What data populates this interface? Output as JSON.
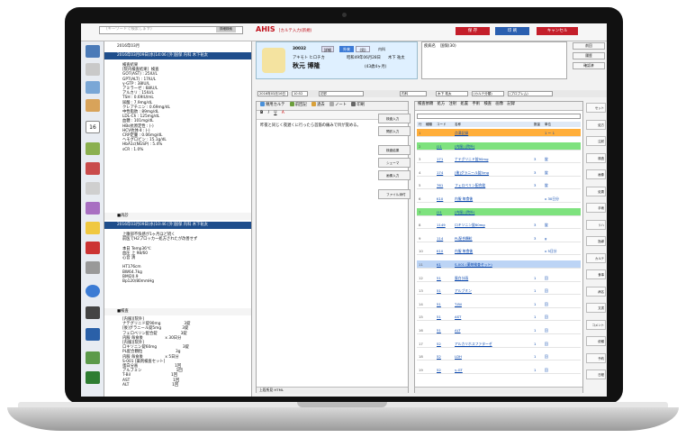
{
  "search": {
    "placeholder": "(キーワードで検索します)",
    "button": "詳細検索"
  },
  "app": {
    "logo": "AHIS",
    "window_title": "[カルテ入力(新規)"
  },
  "topbar": {
    "btn_save": "保 存",
    "btn_print": "印 刷",
    "btn_cancel": "キャンセル"
  },
  "patient": {
    "id": "30032",
    "kana": "アキモト ヒロチカ",
    "name": "秋元 博隆",
    "dob": "昭和49年06月28日",
    "age": "(43歳4ヶ月)",
    "doctor": "木下 祐太",
    "dept": "内科",
    "insurance": "国保(30)",
    "type_out": "外来",
    "sex": "(男)",
    "detail": "詳細"
  },
  "memo": {
    "label": "疾病名",
    "value": "国保(30)"
  },
  "right_side": [
    "前回",
    "履歴",
    "確認済"
  ],
  "filters": {
    "date": "2016年03月16日",
    "time": "10:52",
    "dept": "初診",
    "section": "内科",
    "doctor": "木下 祐太",
    "karte": "(カルテ分類)",
    "problem": "(プロブレム)"
  },
  "history": [
    {
      "header": "2016年03月",
      "kind": "month"
    },
    {
      "header": "2016年03月09日(水)14:06 [外]国保 内科 木下祐太",
      "kind": "visit"
    },
    {
      "text": "検査結果\n[院内検査結果]  検査\nGOT(AST) : 25IU/L\nGPT(ALT) : 17IU/L\nγ-GTP : 38IU/L\nアミラーゼ : 68IU/L\nアルカリ : 15IU/L\nTSH : 0.69IU/mL\n尿酸 : 7.9mg/dL\nクレアチニン : 0.69mg/dL\n中性脂肪 : 89mg/dL\nLDL-Ch : 125mg/dL\n血糖 : 101mg/dL\nHBs抗原定性 : (-)\nHCV抗体-Ⅱ : (-)\nCRP定量 : 0.06mg/dL\nヘモグロビン : 15.1g/dL\nHbA1c(NGSP) : 5.4%\nsCR : 1.0%"
    },
    {
      "header": "■再診",
      "kind": "sub",
      "count": "1"
    },
    {
      "header": "2016年03月09日(水)10:46 [外]国保 内科 木下祐太",
      "kind": "visit"
    },
    {
      "text": "上腹部不快感が1ヶ月ほど続く\n前医でH2ブロッカー処方されたが改善せず\n\n本日 Temp36℃\n血圧 上 98/60\n心音 清\n\nHT176cm\nBW64.7kg\nBMI20.9\nBp120/80mmHg"
    },
    {
      "header": "■検査",
      "kind": "sub",
      "count": "1"
    },
    {
      "text": "[内服][院外]\nナテグリニド錠90mg                   3錠\n[後]グラニール錠5mg                 3錠\nフェロベリン配合錠                   3錠\n内服 毎食後                  x 30日分\n[内服][院外]\nロキソニン錠60mg                     3錠\nPL配合顆粒                           3g\n内服 毎食後                  x 5日分\nS-001 [薬剤検査セット]\n蛋白分画                              1回\nアルブミン                            1回\nT-Bil                                 1回\nAST                                   1回\nALT                                   1回"
    }
  ],
  "editor": {
    "toolbar": [
      "頻用カルテ",
      "前回記",
      "過去",
      "ノート",
      "印刷"
    ],
    "body": "昨夜と同じく夜遅くに行ったら首筋の痛みで目が覚める。",
    "footer": "上段所見  HTML"
  },
  "side_buttons": [
    "検査入力",
    "問診入力",
    "検査結果",
    "シェーマ",
    "画像入力",
    "ファイル添付"
  ],
  "order": {
    "toolbar": [
      "検査依頼",
      "処方",
      "注射",
      "処置",
      "手術",
      "検査",
      "画像",
      "記録"
    ],
    "headers": [
      "行",
      "種類",
      "コード",
      "名称",
      "数量",
      "単位"
    ],
    "rows": [
      {
        "no": "1",
        "code": "",
        "name": "点滴記録",
        "qty": "",
        "unit": "1 ～ 1",
        "hl": "orange"
      },
      {
        "no": "2",
        "code": "J11",
        "name": "[内服]  [院外]",
        "qty": "",
        "unit": "",
        "hl": "green"
      },
      {
        "no": "3",
        "code": "171",
        "name": "ナテグリニド錠90mg",
        "qty": "3",
        "unit": "錠",
        "hl": ""
      },
      {
        "no": "4",
        "code": "174",
        "name": "[後]グラニール錠5mg",
        "qty": "3",
        "unit": "錠",
        "hl": ""
      },
      {
        "no": "5",
        "code": "761",
        "name": "フェロベリン配合錠",
        "qty": "3",
        "unit": "錠",
        "hl": ""
      },
      {
        "no": "6",
        "code": "K10",
        "name": "内服 毎食後",
        "qty": "",
        "unit": "x 30日分",
        "hl": ""
      },
      {
        "no": "7",
        "code": "J11",
        "name": "[内服]  [院外]",
        "qty": "",
        "unit": "",
        "hl": "green"
      },
      {
        "no": "8",
        "code": "1149",
        "name": "ロキソニン錠60mg",
        "qty": "3",
        "unit": "錠",
        "hl": ""
      },
      {
        "no": "9",
        "code": "114",
        "name": "PL配合顆粒",
        "qty": "3",
        "unit": "g",
        "hl": ""
      },
      {
        "no": "10",
        "code": "K10",
        "name": "内服 毎食後",
        "qty": "",
        "unit": "x 5日分",
        "hl": ""
      },
      {
        "no": "11",
        "code": "K1",
        "name": "S-001 (薬剤検査セット)",
        "qty": "",
        "unit": "",
        "hl": "blue"
      },
      {
        "no": "12",
        "code": "51",
        "name": "蛋白分画",
        "qty": "1",
        "unit": "回",
        "hl": ""
      },
      {
        "no": "13",
        "code": "51",
        "name": "アルブミン",
        "qty": "1",
        "unit": "回",
        "hl": ""
      },
      {
        "no": "14",
        "code": "51",
        "name": "T-Bil",
        "qty": "1",
        "unit": "回",
        "hl": ""
      },
      {
        "no": "15",
        "code": "51",
        "name": "AST",
        "qty": "1",
        "unit": "回",
        "hl": ""
      },
      {
        "no": "16",
        "code": "51",
        "name": "ALT",
        "qty": "1",
        "unit": "回",
        "hl": ""
      },
      {
        "no": "17",
        "code": "52",
        "name": "アルカリホスファターゼ",
        "qty": "1",
        "unit": "回",
        "hl": ""
      },
      {
        "no": "18",
        "code": "52",
        "name": "LDH",
        "qty": "1",
        "unit": "回",
        "hl": ""
      },
      {
        "no": "19",
        "code": "52",
        "name": "γ-GT",
        "qty": "1",
        "unit": "回",
        "hl": ""
      }
    ]
  },
  "right_bar": [
    "セット",
    "処方",
    "注射",
    "検査",
    "画像",
    "処置",
    "手術",
    "リハ",
    "指導",
    "カルテ",
    "食事",
    "病名",
    "文書",
    "コメント",
    "依頼",
    "予約",
    "日程"
  ]
}
